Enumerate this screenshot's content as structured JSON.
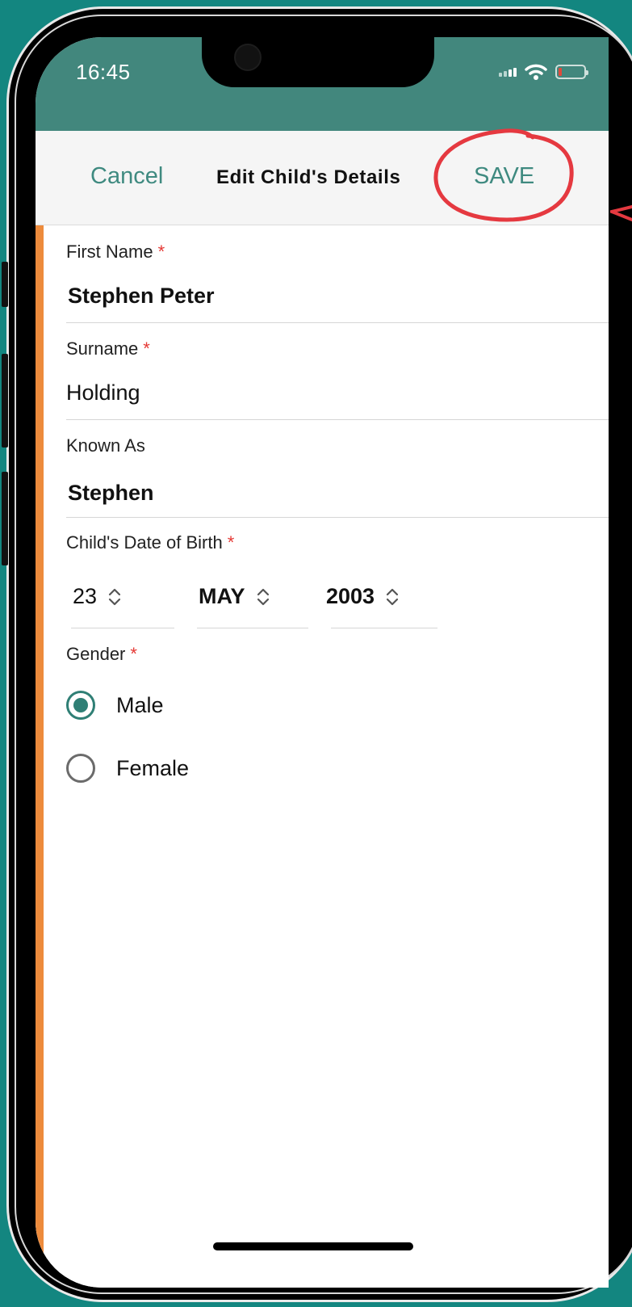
{
  "status": {
    "time": "16:45"
  },
  "nav": {
    "cancel_label": "Cancel",
    "title": "Edit Child's Details",
    "save_label": "SAVE"
  },
  "form": {
    "first_name": {
      "label": "First Name",
      "required": "*",
      "value": "Stephen Peter"
    },
    "surname": {
      "label": "Surname",
      "required": "*",
      "value": "Holding"
    },
    "known_as": {
      "label": "Known As",
      "value": "Stephen"
    },
    "dob": {
      "label": "Child's Date of Birth",
      "required": "*",
      "day": "23",
      "month": "MAY",
      "year": "2003"
    },
    "gender": {
      "label": "Gender",
      "required": "*",
      "options": [
        {
          "label": "Male",
          "selected": true
        },
        {
          "label": "Female",
          "selected": false
        }
      ]
    }
  },
  "colors": {
    "accent": "#3f8a80",
    "status_bar": "#42877d",
    "side_strip": "#ed8b3c",
    "required": "#e53935",
    "annotation": "#e53940"
  },
  "icons": [
    "signal-icon",
    "wifi-icon",
    "battery-icon",
    "chevron-updown-icon"
  ]
}
